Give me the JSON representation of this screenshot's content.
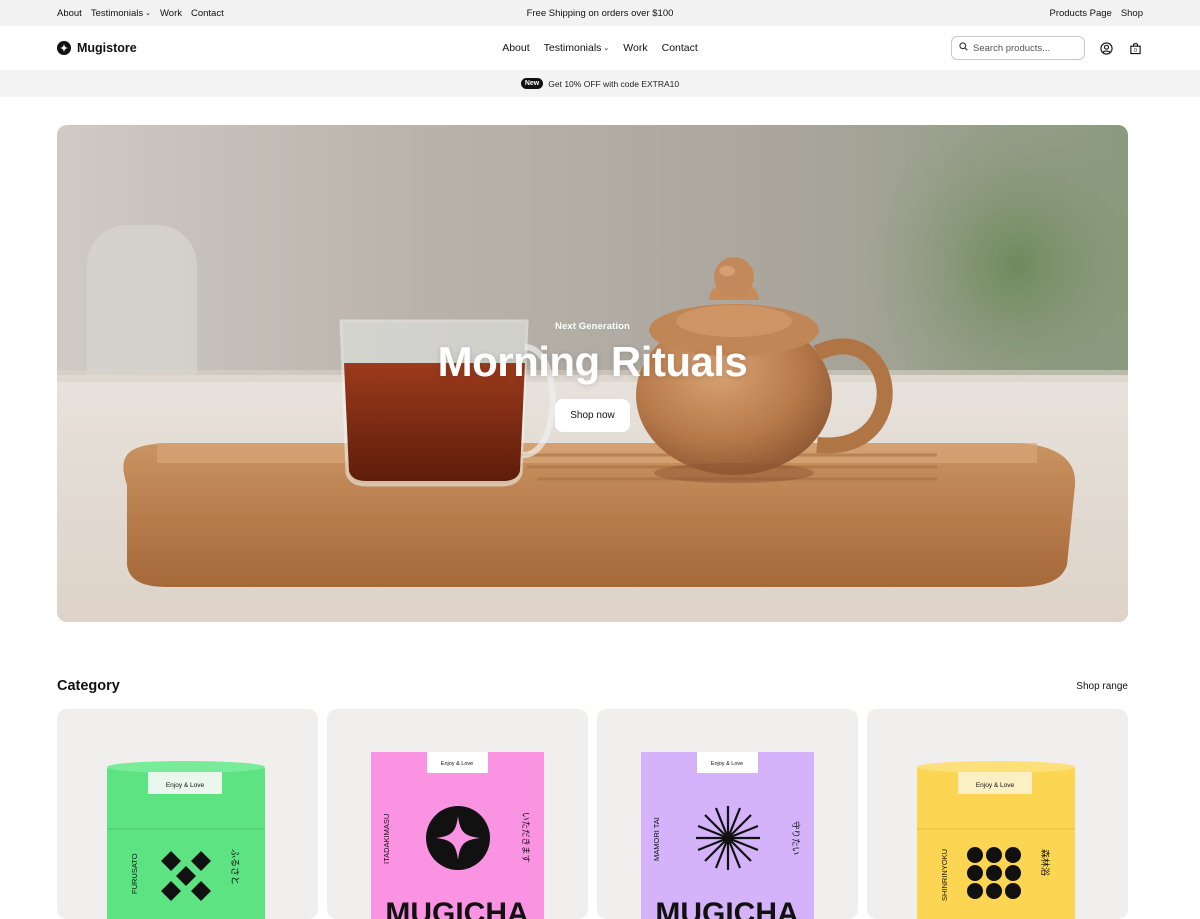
{
  "topbar": {
    "left_links": [
      "About",
      "Testimonials",
      "Work",
      "Contact"
    ],
    "announcement": "Free Shipping on orders over $100",
    "right_links": [
      "Products Page",
      "Shop"
    ]
  },
  "header": {
    "brand": "Mugistore",
    "nav": [
      "About",
      "Testimonials",
      "Work",
      "Contact"
    ],
    "search_placeholder": "Search products...",
    "cart_count": "0"
  },
  "promo": {
    "badge": "New",
    "text": "Get 10% OFF with code EXTRA10"
  },
  "hero": {
    "eyebrow": "Next Generation",
    "title": "Morning Rituals",
    "button": "Shop now"
  },
  "category": {
    "title": "Category",
    "link": "Shop range",
    "cards": [
      {
        "tag": "Enjoy & Love",
        "side_left": "FURUSATO",
        "side_right": "ふるさと",
        "color": "#5ee383"
      },
      {
        "tag": "Enjoy & Love",
        "side_left": "ITADAKIMASU",
        "side_right": "いただきます",
        "color": "#fb93e3",
        "brand": "MUGICHA"
      },
      {
        "tag": "Enjoy & Love",
        "side_left": "MAMORI TAI",
        "side_right": "守りたい",
        "color": "#d4b3fb",
        "brand": "MUGICHA"
      },
      {
        "tag": "Enjoy & Love",
        "side_left": "SHINRINYOKU",
        "side_right": "森林浴",
        "color": "#fcd552"
      }
    ]
  },
  "colors": {
    "topbar_bg": "#f2f2f2",
    "promo_bg": "#f4f4f4",
    "card_bg": "#f1efee"
  }
}
